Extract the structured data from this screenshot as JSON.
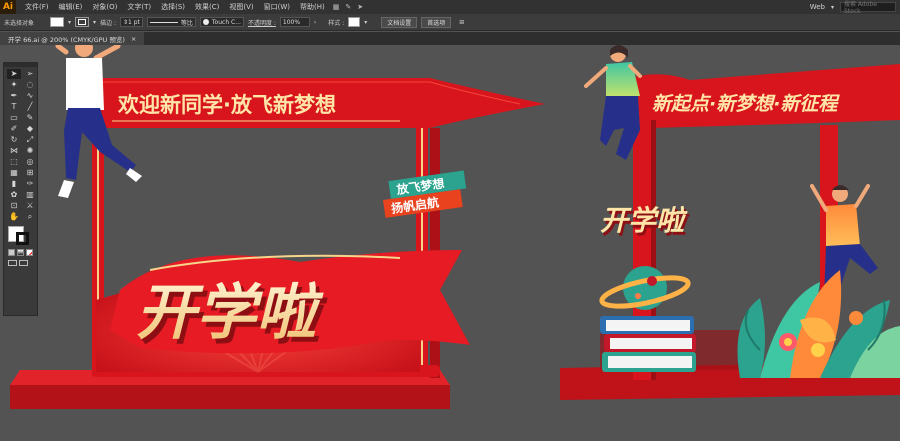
{
  "app": {
    "logo": "Ai"
  },
  "menu": {
    "items": [
      "文件(F)",
      "编辑(E)",
      "对象(O)",
      "文字(T)",
      "选择(S)",
      "效果(C)",
      "视图(V)",
      "窗口(W)",
      "帮助(H)"
    ],
    "icons": [
      "grid-view-icon",
      "brush-icon",
      "send-icon"
    ],
    "workspace": "Web",
    "search_placeholder": "搜索 Adobe Stock"
  },
  "control": {
    "no_selection": "未选择对象",
    "stroke_label": "描边 :",
    "stroke_weight": "1 pt",
    "stroke_profile": "等比",
    "brush": "Touch C...",
    "opacity_label": "不透明度 :",
    "opacity_value": "100%",
    "style_label": "样式 :",
    "doc_setup": "文档设置",
    "prefs": "首选项"
  },
  "tab": {
    "title": "开学 66.ai @ 200% (CMYK/GPU 预览)",
    "close": "×"
  },
  "toolbar": {
    "icons": [
      "selection-tool-icon",
      "direct-selection-tool-icon",
      "magic-wand-tool-icon",
      "lasso-tool-icon",
      "pen-tool-icon",
      "curvature-tool-icon",
      "type-tool-icon",
      "line-segment-tool-icon",
      "rectangle-tool-icon",
      "paintbrush-tool-icon",
      "shaper-tool-icon",
      "eraser-tool-icon",
      "rotate-tool-icon",
      "scale-tool-icon",
      "width-tool-icon",
      "warp-tool-icon",
      "free-transform-tool-icon",
      "shape-builder-tool-icon",
      "perspective-grid-tool-icon",
      "mesh-tool-icon",
      "gradient-tool-icon",
      "eyedropper-tool-icon",
      "symbol-sprayer-tool-icon",
      "column-graph-tool-icon",
      "artboard-tool-icon",
      "slice-tool-icon",
      "hand-tool-icon",
      "zoom-tool-icon"
    ]
  },
  "artwork": {
    "left_banner": "欢迎新同学·放飞新梦想",
    "left_main": "开学啦",
    "badge_top": "放飞梦想",
    "badge_bottom": "扬帆启航",
    "right_banner": "新起点·新梦想·新征程",
    "right_main": "开学啦"
  },
  "colors": {
    "accent_red": "#d8151c",
    "gold": "#f6d58b",
    "teal": "#2ba38e",
    "canvas_bg": "#535353"
  }
}
